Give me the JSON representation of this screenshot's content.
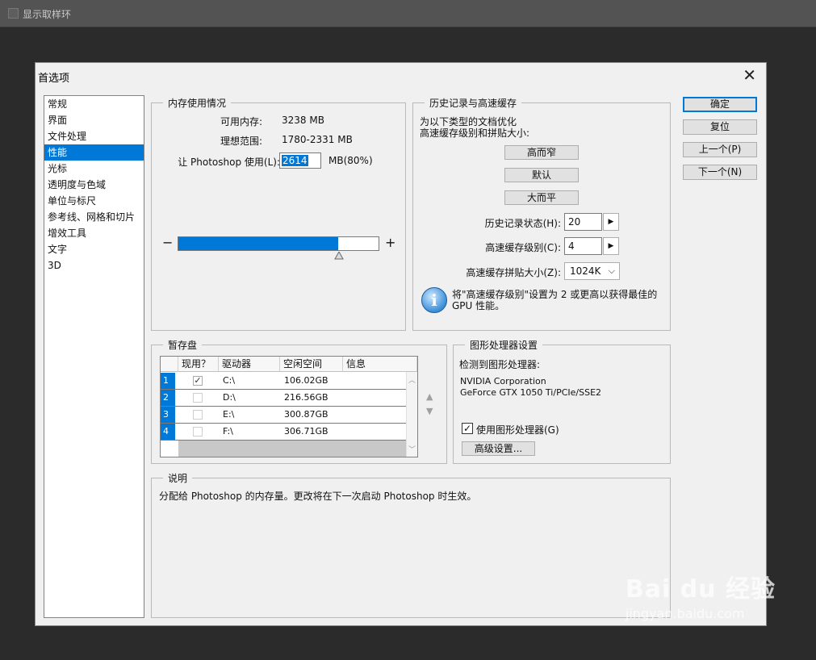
{
  "topbar": {
    "checkbox_label": "显示取样环"
  },
  "dialog": {
    "title": "首选项",
    "close_glyph": "✕"
  },
  "nav": {
    "items": [
      "常规",
      "界面",
      "文件处理",
      "性能",
      "光标",
      "透明度与色域",
      "单位与标尺",
      "参考线、网格和切片",
      "增效工具",
      "文字",
      "3D"
    ],
    "selected": "性能"
  },
  "memory": {
    "title": "内存使用情况",
    "available_label": "可用内存:",
    "available_value": "3238 MB",
    "ideal_label": "理想范围:",
    "ideal_value": "1780-2331 MB",
    "use_label": "让 Photoshop 使用(L):",
    "use_value": "2614",
    "use_unit": "MB(80%)",
    "minus": "−",
    "plus": "+",
    "slider_fraction": 0.8
  },
  "history": {
    "title": "历史记录与高速缓存",
    "desc_line1": "为以下类型的文档优化",
    "desc_line2": "高速缓存级别和拼贴大小:",
    "btn_tall": "高而窄",
    "btn_default": "默认",
    "btn_wide": "大而平",
    "history_states_label": "历史记录状态(H):",
    "history_states_value": "20",
    "cache_levels_label": "高速缓存级别(C):",
    "cache_levels_value": "4",
    "tile_size_label": "高速缓存拼贴大小(Z):",
    "tile_size_value": "1024K",
    "note_line1": "将\"高速缓存级别\"设置为 2 或更高以获得最佳的",
    "note_line2": "GPU 性能。",
    "spin_glyph": "▶",
    "dropdown_glyph": "⌵"
  },
  "scratch": {
    "title": "暂存盘",
    "headers": [
      "现用？",
      "驱动器",
      "空闲空间",
      "信息"
    ],
    "rows": [
      {
        "num": "1",
        "active": true,
        "drive": "C:\\",
        "free": "106.02GB"
      },
      {
        "num": "2",
        "active": false,
        "drive": "D:\\",
        "free": "216.56GB"
      },
      {
        "num": "3",
        "active": false,
        "drive": "E:\\",
        "free": "300.87GB"
      },
      {
        "num": "4",
        "active": false,
        "drive": "F:\\",
        "free": "306.71GB"
      }
    ],
    "check_glyph": "✓",
    "up_glyph": "▲",
    "down_glyph": "▼"
  },
  "gpu": {
    "title": "图形处理器设置",
    "detected_label": "检测到图形处理器:",
    "vendor": "NVIDIA Corporation",
    "model": "GeForce GTX 1050 Ti/PCIe/SSE2",
    "use_gpu_label": "使用图形处理器(G)",
    "use_gpu_checked": true,
    "advanced_button": "高级设置..."
  },
  "description": {
    "title": "说明",
    "text": "分配给 Photoshop 的内存量。更改将在下一次启动 Photoshop 时生效。"
  },
  "buttons": {
    "ok": "确定",
    "reset": "复位",
    "prev": "上一个(P)",
    "next": "下一个(N)"
  },
  "watermark": {
    "brand": "Bai du 经验",
    "url": "jingyan.baidu.com"
  }
}
